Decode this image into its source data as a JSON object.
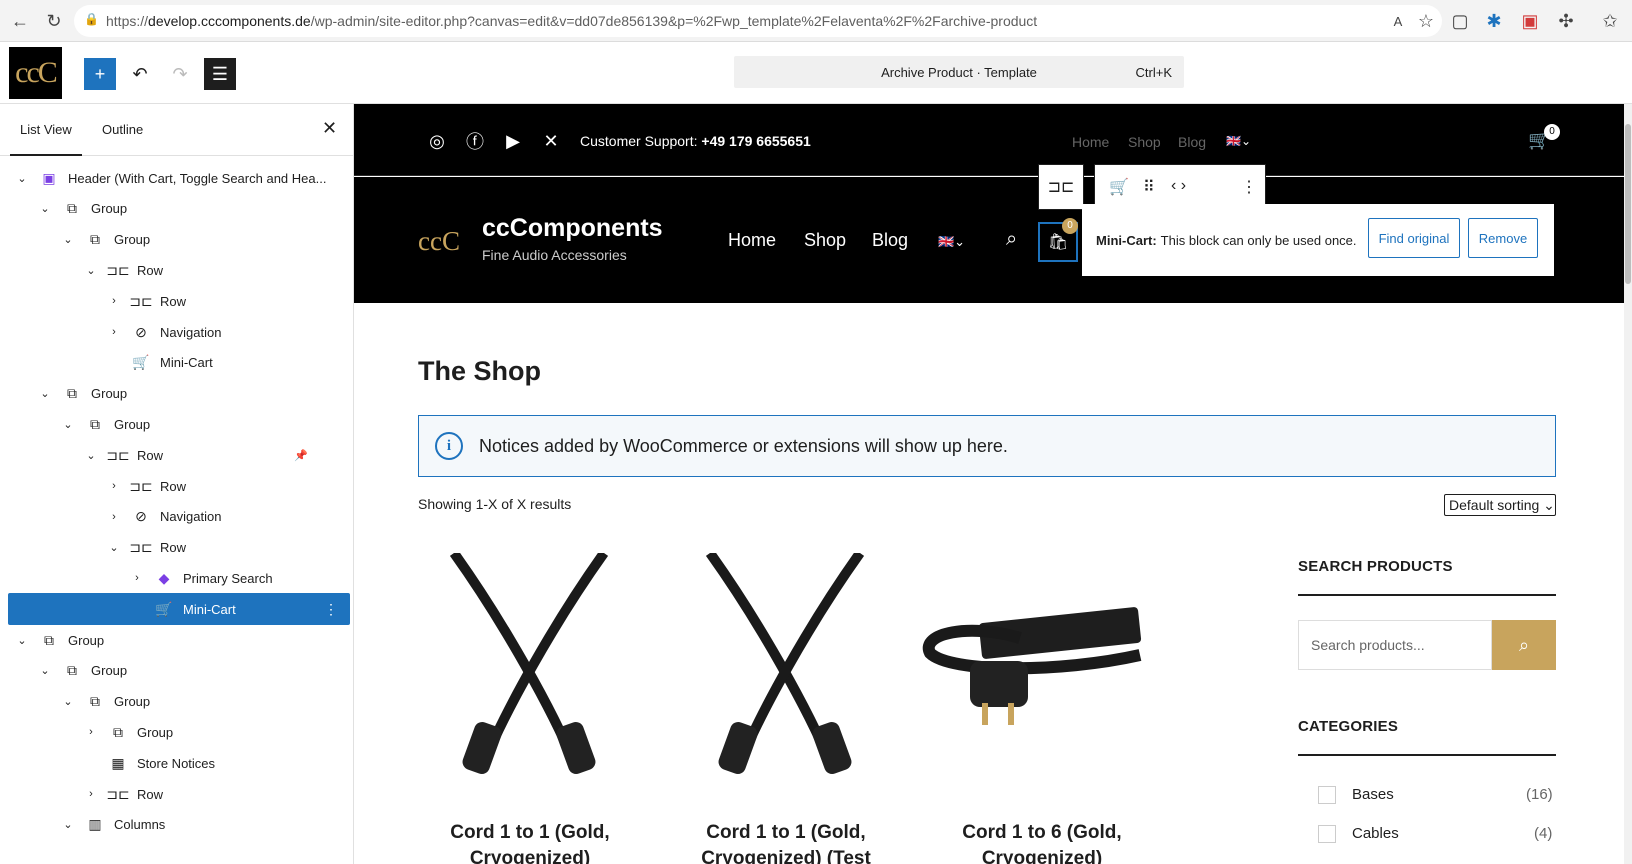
{
  "browser": {
    "url_prefix": "https://",
    "url_domain": "develop.cccomponents.de",
    "url_path": "/wp-admin/site-editor.php?canvas=edit&v=dd07de856139&p=%2Fwp_template%2Felaventa%2F%2Farchive-product"
  },
  "editor": {
    "logo_text": "ccC",
    "doc_title": "Archive Product · Template",
    "doc_shortcut": "Ctrl+K"
  },
  "sidebar": {
    "tabs": [
      "List View",
      "Outline"
    ],
    "rows": [
      {
        "caret": "⌄",
        "icon": "▣",
        "label": "Header (With Cart, Toggle Search and Hea..."
      },
      {
        "caret": "⌄",
        "icon": "⧉",
        "label": "Group"
      },
      {
        "caret": "⌄",
        "icon": "⧉",
        "label": "Group"
      },
      {
        "caret": "⌄",
        "icon": "⊐⊏",
        "label": "Row"
      },
      {
        "caret": "›",
        "icon": "⊐⊏",
        "label": "Row"
      },
      {
        "caret": "›",
        "icon": "⊘",
        "label": "Navigation"
      },
      {
        "caret": "",
        "icon": "🛒",
        "label": "Mini-Cart"
      },
      {
        "caret": "⌄",
        "icon": "⧉",
        "label": "Group"
      },
      {
        "caret": "⌄",
        "icon": "⧉",
        "label": "Group"
      },
      {
        "caret": "⌄",
        "icon": "⊐⊏",
        "label": "Row"
      },
      {
        "caret": "›",
        "icon": "⊐⊏",
        "label": "Row"
      },
      {
        "caret": "›",
        "icon": "⊘",
        "label": "Navigation"
      },
      {
        "caret": "⌄",
        "icon": "⊐⊏",
        "label": "Row"
      },
      {
        "caret": "›",
        "icon": "◆",
        "label": "Primary Search"
      },
      {
        "caret": "",
        "icon": "🛒",
        "label": "Mini-Cart"
      },
      {
        "caret": "⌄",
        "icon": "⧉",
        "label": "Group"
      },
      {
        "caret": "⌄",
        "icon": "⧉",
        "label": "Group"
      },
      {
        "caret": "⌄",
        "icon": "⧉",
        "label": "Group"
      },
      {
        "caret": "›",
        "icon": "⧉",
        "label": "Group"
      },
      {
        "caret": "",
        "icon": "▦",
        "label": "Store Notices"
      },
      {
        "caret": "›",
        "icon": "⊐⊏",
        "label": "Row"
      },
      {
        "caret": "⌄",
        "icon": "▥",
        "label": "Columns"
      }
    ]
  },
  "site": {
    "support_label": "Customer Support:",
    "support_phone": "+49 179 6655651",
    "top_nav": [
      "Home",
      "Shop",
      "Blog"
    ],
    "cart_count": "0",
    "brand_mark": "ccC",
    "brand_name": "ccComponents",
    "brand_tagline": "Fine Audio Accessories",
    "main_nav": [
      "Home",
      "Shop",
      "Blog"
    ],
    "mini_cart_count": "0"
  },
  "tooltip": {
    "title": "Mini-Cart:",
    "message": "This block can only be used once.",
    "find_original": "Find original",
    "remove": "Remove"
  },
  "content": {
    "heading": "The Shop",
    "notice": "Notices added by WooCommerce or extensions will show up here.",
    "results": "Showing 1-X of X results",
    "sorting": "Default sorting",
    "products": [
      {
        "title_line1": "Cord 1 to 1 (Gold,",
        "title_line2": "Cryogenized)"
      },
      {
        "title_line1": "Cord 1 to 1 (Gold,",
        "title_line2": "Cryogenized) (Test"
      },
      {
        "title_line1": "Cord 1 to 6 (Gold,",
        "title_line2": "Cryogenized)"
      }
    ]
  },
  "shop_sidebar": {
    "search_heading": "SEARCH PRODUCTS",
    "search_placeholder": "Search products...",
    "categories_heading": "CATEGORIES",
    "categories": [
      {
        "name": "Bases",
        "count": "(16)"
      },
      {
        "name": "Cables",
        "count": "(4)"
      }
    ]
  },
  "colors": {
    "accent": "#1e73be",
    "gold": "#c8a45d",
    "header_bg": "#000000"
  }
}
